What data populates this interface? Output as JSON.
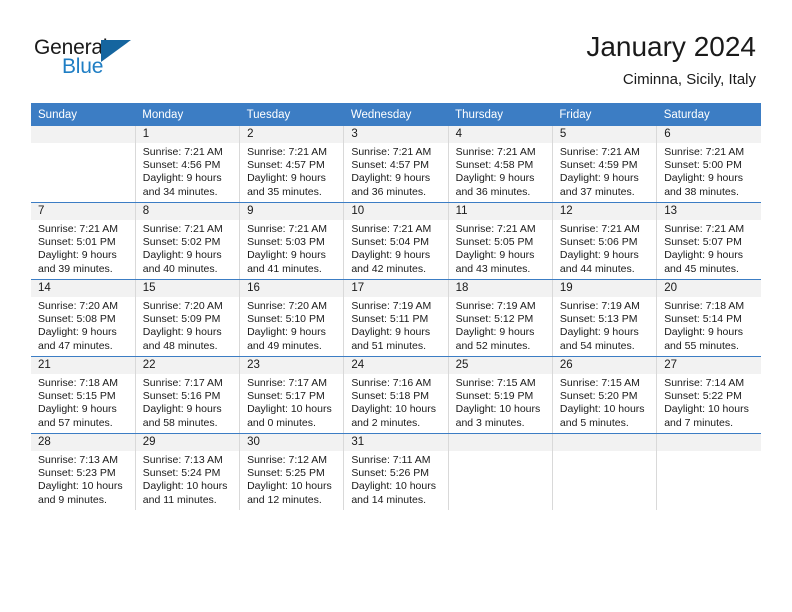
{
  "brand": {
    "word_one": "General",
    "word_two": "Blue",
    "flag_icon": "triangle-flag-icon"
  },
  "header": {
    "title": "January 2024",
    "location": "Ciminna, Sicily, Italy"
  },
  "colors": {
    "header_blue": "#3c7dc4",
    "brand_blue": "#1f7ec4",
    "flag_blue": "#15659f",
    "daynum_bg": "#f2f2f2",
    "cell_border": "#d9d9d9"
  },
  "weekdays": [
    "Sunday",
    "Monday",
    "Tuesday",
    "Wednesday",
    "Thursday",
    "Friday",
    "Saturday"
  ],
  "weeks": [
    [
      {
        "day": "",
        "sunrise": "",
        "sunset": "",
        "daylight_line1": "",
        "daylight_line2": "",
        "empty": true
      },
      {
        "day": "1",
        "sunrise": "Sunrise: 7:21 AM",
        "sunset": "Sunset: 4:56 PM",
        "daylight_line1": "Daylight: 9 hours",
        "daylight_line2": "and 34 minutes."
      },
      {
        "day": "2",
        "sunrise": "Sunrise: 7:21 AM",
        "sunset": "Sunset: 4:57 PM",
        "daylight_line1": "Daylight: 9 hours",
        "daylight_line2": "and 35 minutes."
      },
      {
        "day": "3",
        "sunrise": "Sunrise: 7:21 AM",
        "sunset": "Sunset: 4:57 PM",
        "daylight_line1": "Daylight: 9 hours",
        "daylight_line2": "and 36 minutes."
      },
      {
        "day": "4",
        "sunrise": "Sunrise: 7:21 AM",
        "sunset": "Sunset: 4:58 PM",
        "daylight_line1": "Daylight: 9 hours",
        "daylight_line2": "and 36 minutes."
      },
      {
        "day": "5",
        "sunrise": "Sunrise: 7:21 AM",
        "sunset": "Sunset: 4:59 PM",
        "daylight_line1": "Daylight: 9 hours",
        "daylight_line2": "and 37 minutes."
      },
      {
        "day": "6",
        "sunrise": "Sunrise: 7:21 AM",
        "sunset": "Sunset: 5:00 PM",
        "daylight_line1": "Daylight: 9 hours",
        "daylight_line2": "and 38 minutes."
      }
    ],
    [
      {
        "day": "7",
        "sunrise": "Sunrise: 7:21 AM",
        "sunset": "Sunset: 5:01 PM",
        "daylight_line1": "Daylight: 9 hours",
        "daylight_line2": "and 39 minutes."
      },
      {
        "day": "8",
        "sunrise": "Sunrise: 7:21 AM",
        "sunset": "Sunset: 5:02 PM",
        "daylight_line1": "Daylight: 9 hours",
        "daylight_line2": "and 40 minutes."
      },
      {
        "day": "9",
        "sunrise": "Sunrise: 7:21 AM",
        "sunset": "Sunset: 5:03 PM",
        "daylight_line1": "Daylight: 9 hours",
        "daylight_line2": "and 41 minutes."
      },
      {
        "day": "10",
        "sunrise": "Sunrise: 7:21 AM",
        "sunset": "Sunset: 5:04 PM",
        "daylight_line1": "Daylight: 9 hours",
        "daylight_line2": "and 42 minutes."
      },
      {
        "day": "11",
        "sunrise": "Sunrise: 7:21 AM",
        "sunset": "Sunset: 5:05 PM",
        "daylight_line1": "Daylight: 9 hours",
        "daylight_line2": "and 43 minutes."
      },
      {
        "day": "12",
        "sunrise": "Sunrise: 7:21 AM",
        "sunset": "Sunset: 5:06 PM",
        "daylight_line1": "Daylight: 9 hours",
        "daylight_line2": "and 44 minutes."
      },
      {
        "day": "13",
        "sunrise": "Sunrise: 7:21 AM",
        "sunset": "Sunset: 5:07 PM",
        "daylight_line1": "Daylight: 9 hours",
        "daylight_line2": "and 45 minutes."
      }
    ],
    [
      {
        "day": "14",
        "sunrise": "Sunrise: 7:20 AM",
        "sunset": "Sunset: 5:08 PM",
        "daylight_line1": "Daylight: 9 hours",
        "daylight_line2": "and 47 minutes."
      },
      {
        "day": "15",
        "sunrise": "Sunrise: 7:20 AM",
        "sunset": "Sunset: 5:09 PM",
        "daylight_line1": "Daylight: 9 hours",
        "daylight_line2": "and 48 minutes."
      },
      {
        "day": "16",
        "sunrise": "Sunrise: 7:20 AM",
        "sunset": "Sunset: 5:10 PM",
        "daylight_line1": "Daylight: 9 hours",
        "daylight_line2": "and 49 minutes."
      },
      {
        "day": "17",
        "sunrise": "Sunrise: 7:19 AM",
        "sunset": "Sunset: 5:11 PM",
        "daylight_line1": "Daylight: 9 hours",
        "daylight_line2": "and 51 minutes."
      },
      {
        "day": "18",
        "sunrise": "Sunrise: 7:19 AM",
        "sunset": "Sunset: 5:12 PM",
        "daylight_line1": "Daylight: 9 hours",
        "daylight_line2": "and 52 minutes."
      },
      {
        "day": "19",
        "sunrise": "Sunrise: 7:19 AM",
        "sunset": "Sunset: 5:13 PM",
        "daylight_line1": "Daylight: 9 hours",
        "daylight_line2": "and 54 minutes."
      },
      {
        "day": "20",
        "sunrise": "Sunrise: 7:18 AM",
        "sunset": "Sunset: 5:14 PM",
        "daylight_line1": "Daylight: 9 hours",
        "daylight_line2": "and 55 minutes."
      }
    ],
    [
      {
        "day": "21",
        "sunrise": "Sunrise: 7:18 AM",
        "sunset": "Sunset: 5:15 PM",
        "daylight_line1": "Daylight: 9 hours",
        "daylight_line2": "and 57 minutes."
      },
      {
        "day": "22",
        "sunrise": "Sunrise: 7:17 AM",
        "sunset": "Sunset: 5:16 PM",
        "daylight_line1": "Daylight: 9 hours",
        "daylight_line2": "and 58 minutes."
      },
      {
        "day": "23",
        "sunrise": "Sunrise: 7:17 AM",
        "sunset": "Sunset: 5:17 PM",
        "daylight_line1": "Daylight: 10 hours",
        "daylight_line2": "and 0 minutes."
      },
      {
        "day": "24",
        "sunrise": "Sunrise: 7:16 AM",
        "sunset": "Sunset: 5:18 PM",
        "daylight_line1": "Daylight: 10 hours",
        "daylight_line2": "and 2 minutes."
      },
      {
        "day": "25",
        "sunrise": "Sunrise: 7:15 AM",
        "sunset": "Sunset: 5:19 PM",
        "daylight_line1": "Daylight: 10 hours",
        "daylight_line2": "and 3 minutes."
      },
      {
        "day": "26",
        "sunrise": "Sunrise: 7:15 AM",
        "sunset": "Sunset: 5:20 PM",
        "daylight_line1": "Daylight: 10 hours",
        "daylight_line2": "and 5 minutes."
      },
      {
        "day": "27",
        "sunrise": "Sunrise: 7:14 AM",
        "sunset": "Sunset: 5:22 PM",
        "daylight_line1": "Daylight: 10 hours",
        "daylight_line2": "and 7 minutes."
      }
    ],
    [
      {
        "day": "28",
        "sunrise": "Sunrise: 7:13 AM",
        "sunset": "Sunset: 5:23 PM",
        "daylight_line1": "Daylight: 10 hours",
        "daylight_line2": "and 9 minutes."
      },
      {
        "day": "29",
        "sunrise": "Sunrise: 7:13 AM",
        "sunset": "Sunset: 5:24 PM",
        "daylight_line1": "Daylight: 10 hours",
        "daylight_line2": "and 11 minutes."
      },
      {
        "day": "30",
        "sunrise": "Sunrise: 7:12 AM",
        "sunset": "Sunset: 5:25 PM",
        "daylight_line1": "Daylight: 10 hours",
        "daylight_line2": "and 12 minutes."
      },
      {
        "day": "31",
        "sunrise": "Sunrise: 7:11 AM",
        "sunset": "Sunset: 5:26 PM",
        "daylight_line1": "Daylight: 10 hours",
        "daylight_line2": "and 14 minutes."
      },
      {
        "day": "",
        "sunrise": "",
        "sunset": "",
        "daylight_line1": "",
        "daylight_line2": "",
        "empty": true
      },
      {
        "day": "",
        "sunrise": "",
        "sunset": "",
        "daylight_line1": "",
        "daylight_line2": "",
        "empty": true
      },
      {
        "day": "",
        "sunrise": "",
        "sunset": "",
        "daylight_line1": "",
        "daylight_line2": "",
        "empty": true
      }
    ]
  ]
}
